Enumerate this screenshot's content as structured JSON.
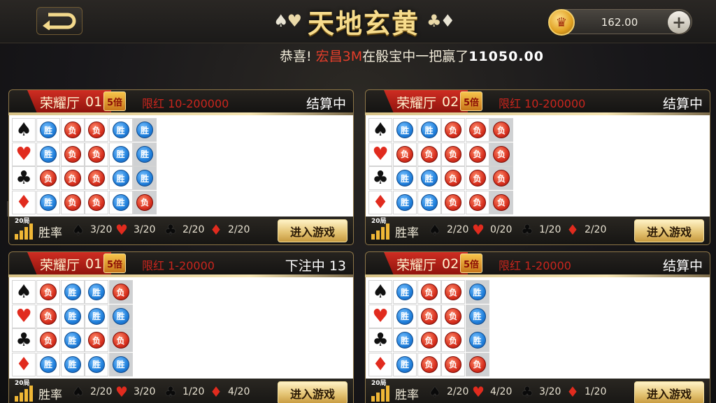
{
  "header": {
    "title": "天地玄黄",
    "balance": "162.00",
    "plus_label": "+",
    "coin_glyph": "♛"
  },
  "marquee": {
    "prefix": "恭喜!",
    "player": "宏昌3M",
    "mid1": "在",
    "game": "骰宝",
    "mid2": "中一把赢了",
    "amount": "11050.00"
  },
  "colors": {
    "win": "#1f7fdb",
    "loss": "#d7301e",
    "accent_gold": "#e5c576",
    "hall_red": "#cf2d22"
  },
  "rounds_label": "20局",
  "winrate_label": "胜率",
  "enter_label": "进入游戏",
  "tables": [
    {
      "hall": "荣耀厅",
      "num": "01",
      "multiplier": "5倍",
      "limit": "限红 10-200000",
      "status": "结算中",
      "rows": [
        [
          "胜",
          "负",
          "负",
          "胜",
          "胜"
        ],
        [
          "胜",
          "负",
          "负",
          "胜",
          "胜"
        ],
        [
          "负",
          "负",
          "负",
          "胜",
          "胜"
        ],
        [
          "胜",
          "负",
          "负",
          "胜",
          "负"
        ]
      ],
      "stats": [
        "3/20",
        "3/20",
        "2/20",
        "2/20"
      ]
    },
    {
      "hall": "荣耀厅",
      "num": "02",
      "multiplier": "5倍",
      "limit": "限红 10-200000",
      "status": "结算中",
      "rows": [
        [
          "胜",
          "胜",
          "负",
          "负",
          "负"
        ],
        [
          "负",
          "负",
          "负",
          "负",
          "负"
        ],
        [
          "胜",
          "胜",
          "负",
          "负",
          "负"
        ],
        [
          "胜",
          "胜",
          "负",
          "负",
          "负"
        ]
      ],
      "stats": [
        "2/20",
        "0/20",
        "1/20",
        "2/20"
      ]
    },
    {
      "hall": "荣耀厅",
      "num": "01",
      "multiplier": "5倍",
      "limit": "限红 1-20000",
      "status": "下注中 13",
      "rows": [
        [
          "负",
          "胜",
          "胜",
          "负"
        ],
        [
          "负",
          "胜",
          "胜",
          "胜"
        ],
        [
          "负",
          "胜",
          "负",
          "负"
        ],
        [
          "胜",
          "胜",
          "胜",
          "胜"
        ]
      ],
      "stats": [
        "2/20",
        "3/20",
        "1/20",
        "4/20"
      ]
    },
    {
      "hall": "荣耀厅",
      "num": "02",
      "multiplier": "5倍",
      "limit": "限红 1-20000",
      "status": "结算中",
      "rows": [
        [
          "胜",
          "负",
          "负",
          "胜"
        ],
        [
          "胜",
          "负",
          "负",
          "胜"
        ],
        [
          "胜",
          "负",
          "负",
          "胜"
        ],
        [
          "胜",
          "负",
          "负",
          "负"
        ]
      ],
      "stats": [
        "2/20",
        "4/20",
        "3/20",
        "1/20"
      ]
    }
  ],
  "suits": [
    {
      "name": "spade",
      "glyph": "♠",
      "color": "black"
    },
    {
      "name": "heart",
      "glyph": "♥",
      "color": "red"
    },
    {
      "name": "club",
      "glyph": "♣",
      "color": "black"
    },
    {
      "name": "diamond",
      "glyph": "♦",
      "color": "red"
    }
  ]
}
